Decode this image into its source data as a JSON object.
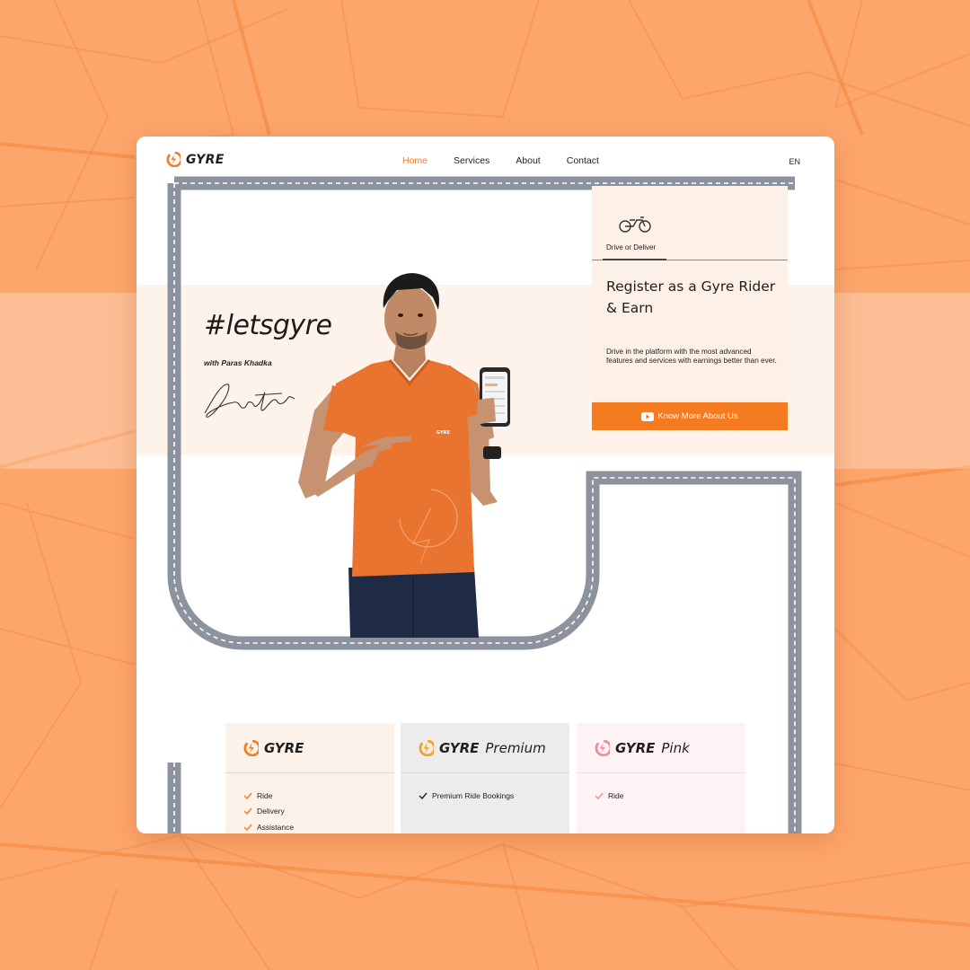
{
  "colors": {
    "brand_orange": "#f47b20",
    "background": "#fda66c",
    "pink_accent": "#ee8c9c",
    "road_gray": "#8d939e"
  },
  "header": {
    "logo_text": "GYRE",
    "nav": [
      "Home",
      "Services",
      "About",
      "Contact"
    ],
    "active_nav": "Home",
    "language": "EN"
  },
  "hero": {
    "hashtag": "#letsgyre",
    "with_text": "with Paras Khadka",
    "shirt_logo_text": "GYRE"
  },
  "register_card": {
    "tab_icon": "motorbike-icon",
    "tab_label": "Drive or Deliver",
    "title": "Register as a Gyre Rider & Earn",
    "description": "Drive in the platform with the most advanced features and services with earnings better than ever.",
    "button_icon": "youtube-play-icon",
    "button_label": "Know More About Us"
  },
  "plans": [
    {
      "brand": "GYRE",
      "suffix": "",
      "logo_color": "#f47b20",
      "features": [
        "Ride",
        "Delivery",
        "Assistance"
      ]
    },
    {
      "brand": "GYRE",
      "suffix": "Premium",
      "logo_color": "#f5a21e",
      "features": [
        "Premium Ride Bookings"
      ]
    },
    {
      "brand": "GYRE",
      "suffix": "Pink",
      "logo_color": "#ee8c9c",
      "features": [
        "Ride"
      ]
    }
  ]
}
